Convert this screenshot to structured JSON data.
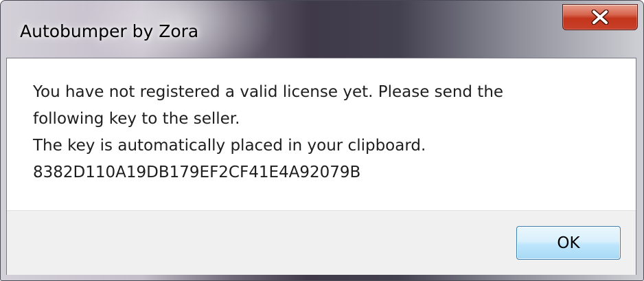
{
  "window": {
    "title": "Autobumper by Zora",
    "close_icon": "close-x-icon",
    "close_color": "#c3351b"
  },
  "dialog": {
    "message_lines": [
      "You have not registered a valid license yet. Please send the",
      "following key to the seller.",
      "The key is automatically placed in your clipboard.",
      "8382D110A19DB179EF2CF41E4A92079B"
    ],
    "ok_label": "OK"
  }
}
